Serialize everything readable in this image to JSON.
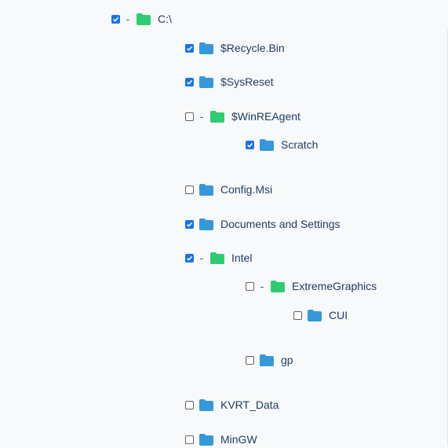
{
  "colors": {
    "expanded_folder": "#2ecc71",
    "collapsed_folder": "#3498db",
    "checkbox_checked": "#1a73e8",
    "label_text": "#1f3a5f"
  },
  "tree": {
    "toggle_symbol": "-",
    "nodes": [
      {
        "label": "C:\\",
        "checked": true,
        "expanded": true
      },
      {
        "label": "$Recycle.Bin",
        "checked": true,
        "expanded": false
      },
      {
        "label": "$SysReset",
        "checked": true,
        "expanded": false
      },
      {
        "label": "$WinREAgent",
        "checked": false,
        "expanded": true
      },
      {
        "label": "Scratch",
        "checked": true,
        "expanded": false
      },
      {
        "label": "Config.Msi",
        "checked": false,
        "expanded": false
      },
      {
        "label": "Documents and Settings",
        "checked": true,
        "expanded": false
      },
      {
        "label": "Intel",
        "checked": true,
        "expanded": true
      },
      {
        "label": "ExtremeGraphics",
        "checked": false,
        "expanded": true
      },
      {
        "label": "CUI",
        "checked": false,
        "expanded": false
      },
      {
        "label": "gp",
        "checked": false,
        "expanded": false
      },
      {
        "label": "KVRT_Data",
        "checked": false,
        "expanded": false
      },
      {
        "label": "MinGW",
        "checked": false,
        "expanded": false
      }
    ]
  }
}
